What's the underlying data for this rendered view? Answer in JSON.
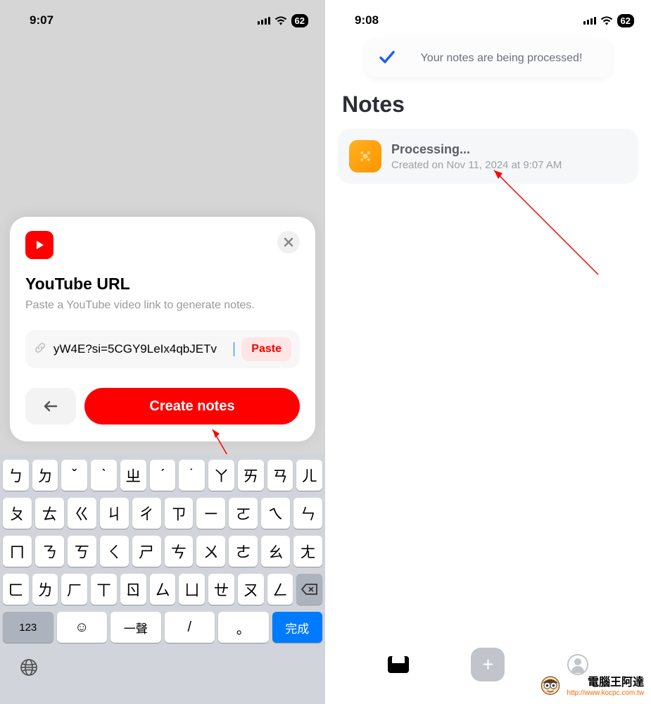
{
  "left": {
    "status": {
      "time": "9:07",
      "battery": "62"
    },
    "sheet": {
      "title": "YouTube URL",
      "subtitle": "Paste a YouTube video link to generate notes.",
      "url_value": "yW4E?si=5CGY9LeIx4qbJETv",
      "paste_label": "Paste",
      "create_label": "Create notes"
    },
    "keyboard": {
      "row1": [
        "ㄅ",
        "ㄉ",
        "ˇ",
        "ˋ",
        "ㄓ",
        "ˊ",
        "˙",
        "ㄚ",
        "ㄞ",
        "ㄢ",
        "ㄦ"
      ],
      "row2": [
        "ㄆ",
        "ㄊ",
        "ㄍ",
        "ㄐ",
        "ㄔ",
        "ㄗ",
        "ㄧ",
        "ㄛ",
        "ㄟ",
        "ㄣ"
      ],
      "row3": [
        "ㄇ",
        "ㄋ",
        "ㄎ",
        "ㄑ",
        "ㄕ",
        "ㄘ",
        "ㄨ",
        "ㄜ",
        "ㄠ",
        "ㄤ"
      ],
      "row4": [
        "ㄈ",
        "ㄌ",
        "ㄏ",
        "ㄒ",
        "ㄖ",
        "ㄙ",
        "ㄩ",
        "ㄝ",
        "ㄡ",
        "ㄥ"
      ],
      "k123": "123",
      "tone": "一聲",
      "slash": "/",
      "dot": "。",
      "done": "完成"
    }
  },
  "right": {
    "status": {
      "time": "9:08",
      "battery": "62"
    },
    "toast": "Your notes are being processed!",
    "page_title": "Notes",
    "note": {
      "title": "Processing...",
      "subtitle": "Created on Nov 11, 2024 at 9:07 AM"
    }
  },
  "watermark": {
    "main": "電腦王阿達",
    "sub": "http://www.kocpc.com.tw"
  }
}
